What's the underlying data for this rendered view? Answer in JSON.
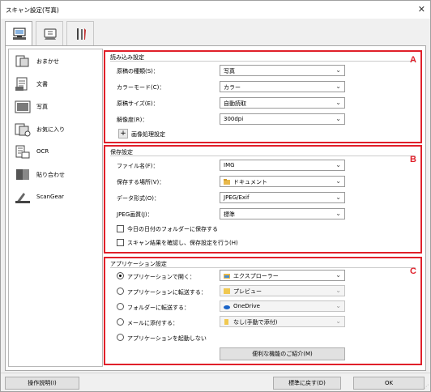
{
  "window": {
    "title": "スキャン設定(写真)"
  },
  "tabs": [
    {
      "icon": "scanner-from-computer-icon",
      "active": true
    },
    {
      "icon": "scanner-from-panel-icon",
      "active": false
    },
    {
      "icon": "general-settings-tools-icon",
      "active": false
    }
  ],
  "sidebar": {
    "items": [
      {
        "label": "おまかせ",
        "icon": "auto-scan-icon",
        "active": false
      },
      {
        "label": "文書",
        "icon": "document-icon",
        "active": false
      },
      {
        "label": "写真",
        "icon": "photo-icon",
        "active": true
      },
      {
        "label": "お気に入り",
        "icon": "favorites-icon",
        "active": false
      },
      {
        "label": "OCR",
        "icon": "ocr-icon",
        "active": false
      },
      {
        "label": "貼り合わせ",
        "icon": "stitch-icon",
        "active": false
      },
      {
        "label": "ScanGear",
        "icon": "scangear-icon",
        "active": false
      }
    ]
  },
  "scan_options": {
    "header": "読み込み設定",
    "letter": "A",
    "fields": [
      {
        "label": "原稿の種類(S)：",
        "value": "写真"
      },
      {
        "label": "カラーモード(C)：",
        "value": "カラー"
      },
      {
        "label": "原稿サイズ(E)：",
        "value": "自動読取"
      },
      {
        "label": "解像度(R)：",
        "value": "300dpi"
      }
    ],
    "image_processing_label": "画像処理設定",
    "expand_symbol": "+"
  },
  "save_settings": {
    "header": "保存設定",
    "letter": "B",
    "fields": [
      {
        "label": "ファイル名(F)：",
        "value": "IMG"
      },
      {
        "label": "保存する場所(V)：",
        "value": "ドキュメント"
      },
      {
        "label": "データ形式(O)：",
        "value": "JPEG/Exif"
      },
      {
        "label": "JPEG画質(J)：",
        "value": "標準"
      }
    ],
    "checkbox_date_folder": "今日の日付のフォルダーに保存する",
    "checkbox_confirm": "スキャン結果を確認し、保存設定を行う(H)"
  },
  "app_settings": {
    "header": "アプリケーション設定",
    "letter": "C",
    "options": [
      {
        "label": "アプリケーションで開く：",
        "value": "エクスプローラー",
        "selected": true,
        "enabled": true
      },
      {
        "label": "アプリケーションに転送する：",
        "value": "プレビュー",
        "selected": false,
        "enabled": false
      },
      {
        "label": "フォルダーに転送する：",
        "value": "OneDrive",
        "selected": false,
        "enabled": false
      },
      {
        "label": "メールに添付する：",
        "value": "なし(手動で添付)",
        "selected": false,
        "enabled": false
      },
      {
        "label": "アプリケーションを起動しない",
        "selected": false
      }
    ],
    "more_functions_button": "便利な機能のご紹介(M)"
  },
  "footer": {
    "instructions_button": "操作説明(I)",
    "defaults_button": "標準に戻す(D)",
    "ok_button": "OK"
  },
  "colors": {
    "accent": "#0078d7",
    "highlight_border": "#e0202a"
  }
}
